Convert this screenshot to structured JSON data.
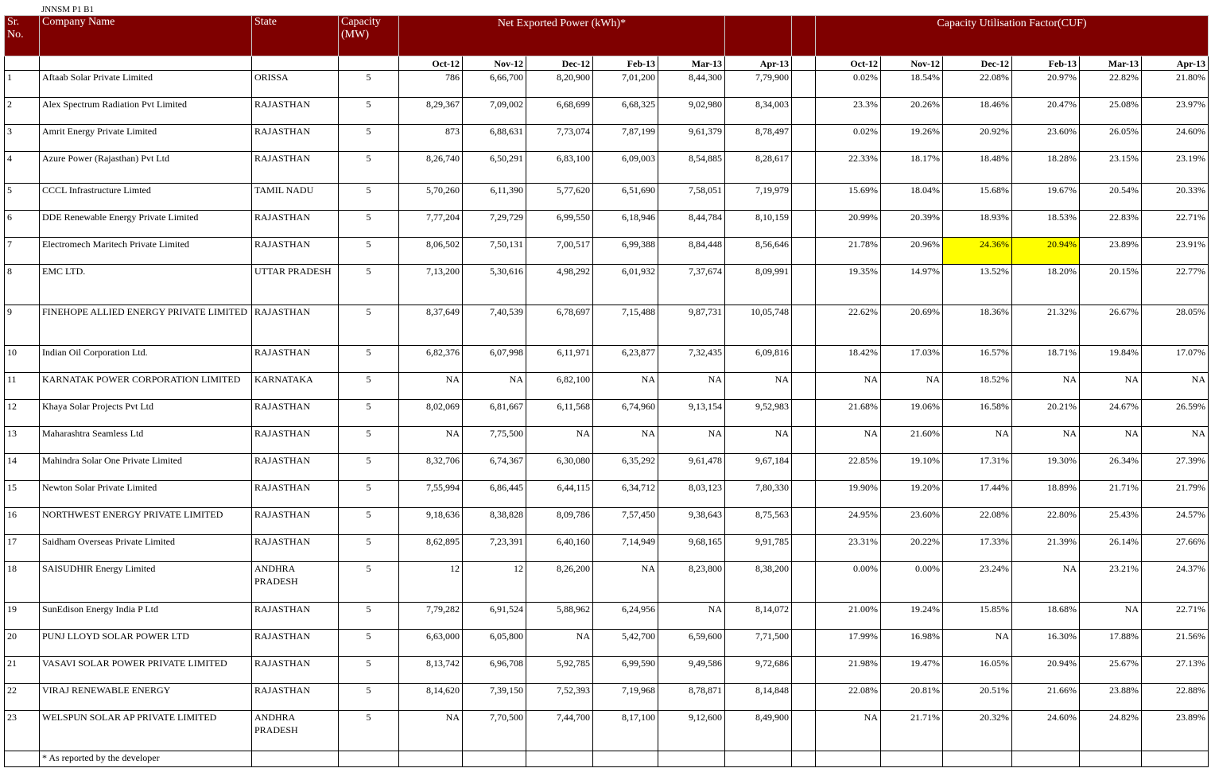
{
  "caption": "JNNSM P1 B1",
  "headers": {
    "sr_no": "Sr. No.",
    "company": "Company Name",
    "state": "State",
    "capacity": "Capacity (MW)",
    "net_power": "Net Exported  Power  (kWh)*",
    "cuf": "Capacity Utilisation Factor(CUF)"
  },
  "months": [
    "Oct-12",
    "Nov-12",
    "Dec-12",
    "Feb-13",
    "Mar-13",
    "Apr-13"
  ],
  "rows": [
    {
      "sr": "1",
      "company": "Aftaab Solar Private Limited",
      "state": "ORISSA",
      "cap": "5",
      "power": [
        "786",
        "6,66,700",
        "8,20,900",
        "7,01,200",
        "8,44,300",
        "7,79,900"
      ],
      "cuf": [
        "0.02%",
        "18.54%",
        "22.08%",
        "20.97%",
        "22.82%",
        "21.80%"
      ]
    },
    {
      "sr": "2",
      "company": "Alex Spectrum Radiation Pvt Limited",
      "state": "RAJASTHAN",
      "cap": "5",
      "power": [
        "8,29,367",
        "7,09,002",
        "6,68,699",
        "6,68,325",
        "9,02,980",
        "8,34,003"
      ],
      "cuf": [
        "23.3%",
        "20.26%",
        "18.46%",
        "20.47%",
        "25.08%",
        "23.97%"
      ]
    },
    {
      "sr": "3",
      "company": "Amrit Energy Private Limited",
      "state": "RAJASTHAN",
      "cap": "5",
      "power": [
        "873",
        "6,88,631",
        "7,73,074",
        "7,87,199",
        "9,61,379",
        "8,78,497"
      ],
      "cuf": [
        "0.02%",
        "19.26%",
        "20.92%",
        "23.60%",
        "26.05%",
        "24.60%"
      ]
    },
    {
      "sr": "4",
      "company": "Azure Power (Rajasthan) Pvt Ltd",
      "state": "RAJASTHAN",
      "cap": "5",
      "power": [
        "8,26,740",
        "6,50,291",
        "6,83,100",
        "6,09,003",
        "8,54,885",
        "8,28,617"
      ],
      "cuf": [
        "22.33%",
        "18.17%",
        "18.48%",
        "18.28%",
        "23.15%",
        "23.19%"
      ]
    },
    {
      "sr": "5",
      "company": "CCCL Infrastructure Limted",
      "state": "TAMIL NADU",
      "cap": "5",
      "power": [
        "5,70,260",
        "6,11,390",
        "5,77,620",
        "6,51,690",
        "7,58,051",
        "7,19,979"
      ],
      "cuf": [
        "15.69%",
        "18.04%",
        "15.68%",
        "19.67%",
        "20.54%",
        "20.33%"
      ]
    },
    {
      "sr": "6",
      "company": "DDE Renewable Energy Private Limited",
      "state": "RAJASTHAN",
      "cap": "5",
      "power": [
        "7,77,204",
        "7,29,729",
        "6,99,550",
        "6,18,946",
        "8,44,784",
        "8,10,159"
      ],
      "cuf": [
        "20.99%",
        "20.39%",
        "18.93%",
        "18.53%",
        "22.83%",
        "22.71%"
      ]
    },
    {
      "sr": "7",
      "company": "Electromech Maritech Private Limited",
      "state": "RAJASTHAN",
      "cap": "5",
      "power": [
        "8,06,502",
        "7,50,131",
        "7,00,517",
        "6,99,388",
        "8,84,448",
        "8,56,646"
      ],
      "cuf": [
        "21.78%",
        "20.96%",
        "24.36%",
        "20.94%",
        "23.89%",
        "23.91%"
      ]
    },
    {
      "sr": "8",
      "company": "EMC LTD.",
      "state": "UTTAR PRADESH",
      "cap": "5",
      "power": [
        "7,13,200",
        "5,30,616",
        "4,98,292",
        "6,01,932",
        "7,37,674",
        "8,09,991"
      ],
      "cuf": [
        "19.35%",
        "14.97%",
        "13.52%",
        "18.20%",
        "20.15%",
        "22.77%"
      ]
    },
    {
      "sr": "9",
      "company": "FINEHOPE ALLIED ENERGY PRIVATE LIMITED",
      "state": "RAJASTHAN",
      "cap": "5",
      "power": [
        "8,37,649",
        "7,40,539",
        "6,78,697",
        "7,15,488",
        "9,87,731",
        "10,05,748"
      ],
      "cuf": [
        "22.62%",
        "20.69%",
        "18.36%",
        "21.32%",
        "26.67%",
        "28.05%"
      ]
    },
    {
      "sr": "10",
      "company": "Indian Oil Corporation Ltd.",
      "state": "RAJASTHAN",
      "cap": "5",
      "power": [
        "6,82,376",
        "6,07,998",
        "6,11,971",
        "6,23,877",
        "7,32,435",
        "6,09,816"
      ],
      "cuf": [
        "18.42%",
        "17.03%",
        "16.57%",
        "18.71%",
        "19.84%",
        "17.07%"
      ]
    },
    {
      "sr": "11",
      "company": "KARNATAK POWER CORPORATION LIMITED",
      "state": "KARNATAKA",
      "cap": "5",
      "power": [
        "NA",
        "NA",
        "6,82,100",
        "NA",
        "NA",
        "NA"
      ],
      "cuf": [
        "NA",
        "NA",
        "18.52%",
        "NA",
        "NA",
        "NA"
      ]
    },
    {
      "sr": "12",
      "company": "Khaya Solar Projects Pvt Ltd",
      "state": "RAJASTHAN",
      "cap": "5",
      "power": [
        "8,02,069",
        "6,81,667",
        "6,11,568",
        "6,74,960",
        "9,13,154",
        "9,52,983"
      ],
      "cuf": [
        "21.68%",
        "19.06%",
        "16.58%",
        "20.21%",
        "24.67%",
        "26.59%"
      ]
    },
    {
      "sr": "13",
      "company": "Maharashtra Seamless Ltd",
      "state": "RAJASTHAN",
      "cap": "5",
      "power": [
        "NA",
        "7,75,500",
        "NA",
        "NA",
        "NA",
        "NA"
      ],
      "cuf": [
        "NA",
        "21.60%",
        "NA",
        "NA",
        "NA",
        "NA"
      ]
    },
    {
      "sr": "14",
      "company": "Mahindra Solar One Private Limited",
      "state": "RAJASTHAN",
      "cap": "5",
      "power": [
        "8,32,706",
        "6,74,367",
        "6,30,080",
        "6,35,292",
        "9,61,478",
        "9,67,184"
      ],
      "cuf": [
        "22.85%",
        "19.10%",
        "17.31%",
        "19.30%",
        "26.34%",
        "27.39%"
      ]
    },
    {
      "sr": "15",
      "company": "Newton Solar Private Limited",
      "state": "RAJASTHAN",
      "cap": "5",
      "power": [
        "7,55,994",
        "6,86,445",
        "6,44,115",
        "6,34,712",
        "8,03,123",
        "7,80,330"
      ],
      "cuf": [
        "19.90%",
        "19.20%",
        "17.44%",
        "18.89%",
        "21.71%",
        "21.79%"
      ]
    },
    {
      "sr": "16",
      "company": "NORTHWEST ENERGY PRIVATE LIMITED",
      "state": "RAJASTHAN",
      "cap": "5",
      "power": [
        "9,18,636",
        "8,38,828",
        "8,09,786",
        "7,57,450",
        "9,38,643",
        "8,75,563"
      ],
      "cuf": [
        "24.95%",
        "23.60%",
        "22.08%",
        "22.80%",
        "25.43%",
        "24.57%"
      ]
    },
    {
      "sr": "17",
      "company": "Saidham Overseas Private Limited",
      "state": "RAJASTHAN",
      "cap": "5",
      "power": [
        "8,62,895",
        "7,23,391",
        "6,40,160",
        "7,14,949",
        "9,68,165",
        "9,91,785"
      ],
      "cuf": [
        "23.31%",
        "20.22%",
        "17.33%",
        "21.39%",
        "26.14%",
        "27.66%"
      ]
    },
    {
      "sr": "18",
      "company": "SAISUDHIR Energy Limited",
      "state": "ANDHRA PRADESH",
      "cap": "5",
      "power": [
        "12",
        "12",
        "8,26,200",
        "NA",
        "8,23,800",
        "8,38,200"
      ],
      "cuf": [
        "0.00%",
        "0.00%",
        "23.24%",
        "NA",
        "23.21%",
        "24.37%"
      ]
    },
    {
      "sr": "19",
      "company": "SunEdison Energy India P Ltd",
      "state": "RAJASTHAN",
      "cap": "5",
      "power": [
        "7,79,282",
        "6,91,524",
        "5,88,962",
        "6,24,956",
        "NA",
        "8,14,072"
      ],
      "cuf": [
        "21.00%",
        "19.24%",
        "15.85%",
        "18.68%",
        "NA",
        "22.71%"
      ]
    },
    {
      "sr": "20",
      "company": "PUNJ LLOYD SOLAR POWER LTD",
      "state": "RAJASTHAN",
      "cap": "5",
      "power": [
        "6,63,000",
        "6,05,800",
        "NA",
        "5,42,700",
        "6,59,600",
        "7,71,500"
      ],
      "cuf": [
        "17.99%",
        "16.98%",
        "NA",
        "16.30%",
        "17.88%",
        "21.56%"
      ]
    },
    {
      "sr": "21",
      "company": "VASAVI SOLAR POWER PRIVATE LIMITED",
      "state": "RAJASTHAN",
      "cap": "5",
      "power": [
        "8,13,742",
        "6,96,708",
        "5,92,785",
        "6,99,590",
        "9,49,586",
        "9,72,686"
      ],
      "cuf": [
        "21.98%",
        "19.47%",
        "16.05%",
        "20.94%",
        "25.67%",
        "27.13%"
      ]
    },
    {
      "sr": "22",
      "company": "VIRAJ RENEWABLE ENERGY",
      "state": "RAJASTHAN",
      "cap": "5",
      "power": [
        "8,14,620",
        "7,39,150",
        "7,52,393",
        "7,19,968",
        "8,78,871",
        "8,14,848"
      ],
      "cuf": [
        "22.08%",
        "20.81%",
        "20.51%",
        "21.66%",
        "23.88%",
        "22.88%"
      ]
    },
    {
      "sr": "23",
      "company": "WELSPUN SOLAR AP PRIVATE LIMITED",
      "state": "ANDHRA PRADESH",
      "cap": "5",
      "power": [
        "NA",
        "7,70,500",
        "7,44,700",
        "8,17,100",
        "9,12,600",
        "8,49,900"
      ],
      "cuf": [
        "NA",
        "21.71%",
        "20.32%",
        "24.60%",
        "24.82%",
        "23.89%"
      ]
    }
  ],
  "footnote": "* As reported by the developer",
  "colors": {
    "header_bg": "#7f0000",
    "header_text": "#ffffff",
    "highlight": "#ffff00"
  }
}
